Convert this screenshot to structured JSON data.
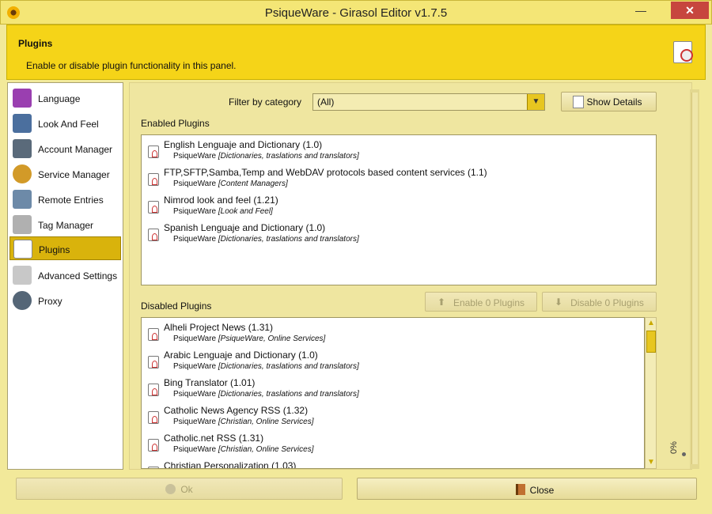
{
  "window": {
    "title": "PsiqueWare - Girasol Editor v1.7.5",
    "minimize_glyph": "—",
    "close_glyph": "✕"
  },
  "header": {
    "title": "Plugins",
    "description": "Enable or disable plugin functionality in this panel."
  },
  "sidebar": {
    "items": [
      {
        "label": "Language",
        "icon": "language-icon",
        "color": "#9a3fb0"
      },
      {
        "label": "Look And Feel",
        "icon": "monitor-icon",
        "color": "#4b6f9e"
      },
      {
        "label": "Account Manager",
        "icon": "account-icon",
        "color": "#5a6a7a"
      },
      {
        "label": "Service Manager",
        "icon": "users-icon",
        "color": "#d29a28"
      },
      {
        "label": "Remote Entries",
        "icon": "magnifier-icon",
        "color": "#6d8aa8"
      },
      {
        "label": "Tag Manager",
        "icon": "tag-icon",
        "color": "#b0b0b0"
      },
      {
        "label": "Plugins",
        "icon": "plugin-icon",
        "color": "#c33333"
      },
      {
        "label": "Advanced Settings",
        "icon": "settings-icon",
        "color": "#c8c8c8"
      },
      {
        "label": "Proxy",
        "icon": "proxy-icon",
        "color": "#556677"
      }
    ],
    "selected": "Plugins"
  },
  "filter": {
    "label": "Filter by category",
    "value": "(All)",
    "arrow": "▼"
  },
  "buttons": {
    "show_details": "Show Details",
    "enable": "Enable 0 Plugins",
    "disable": "Disable 0 Plugins",
    "ok": "Ok",
    "close": "Close"
  },
  "enabled_section": {
    "label": "Enabled Plugins",
    "plugins": [
      {
        "name": "English Lenguaje and Dictionary (1.0)",
        "vendor": "PsiqueWare",
        "category": "[Dictionaries, traslations and translators]"
      },
      {
        "name": "FTP,SFTP,Samba,Temp and WebDAV protocols based content services (1.1)",
        "vendor": "PsiqueWare",
        "category": "[Content Managers]"
      },
      {
        "name": "Nimrod look and feel (1.21)",
        "vendor": "PsiqueWare",
        "category": "[Look and Feel]"
      },
      {
        "name": "Spanish Lenguaje and Dictionary (1.0)",
        "vendor": "PsiqueWare",
        "category": "[Dictionaries, traslations and translators]"
      }
    ]
  },
  "disabled_section": {
    "label": "Disabled Plugins",
    "plugins": [
      {
        "name": "Alheli Project News (1.31)",
        "vendor": "PsiqueWare",
        "category": "[PsiqueWare, Online Services]"
      },
      {
        "name": "Arabic Lenguaje and Dictionary (1.0)",
        "vendor": "PsiqueWare",
        "category": "[Dictionaries, traslations and translators]"
      },
      {
        "name": "Bing Translator (1.01)",
        "vendor": "PsiqueWare",
        "category": "[Dictionaries, traslations and translators]"
      },
      {
        "name": "Catholic News Agency RSS (1.32)",
        "vendor": "PsiqueWare",
        "category": "[Christian, Online Services]"
      },
      {
        "name": "Catholic.net RSS (1.31)",
        "vendor": "PsiqueWare",
        "category": "[Christian, Online Services]"
      },
      {
        "name": "Christian Personalization (1.03)",
        "vendor": "",
        "category": ""
      }
    ]
  },
  "progress": {
    "value": 0,
    "label": "0%"
  },
  "colors": {
    "accent": "#f5d418",
    "selected_item": "#d9b30c",
    "window_bg": "#f2e99a"
  }
}
